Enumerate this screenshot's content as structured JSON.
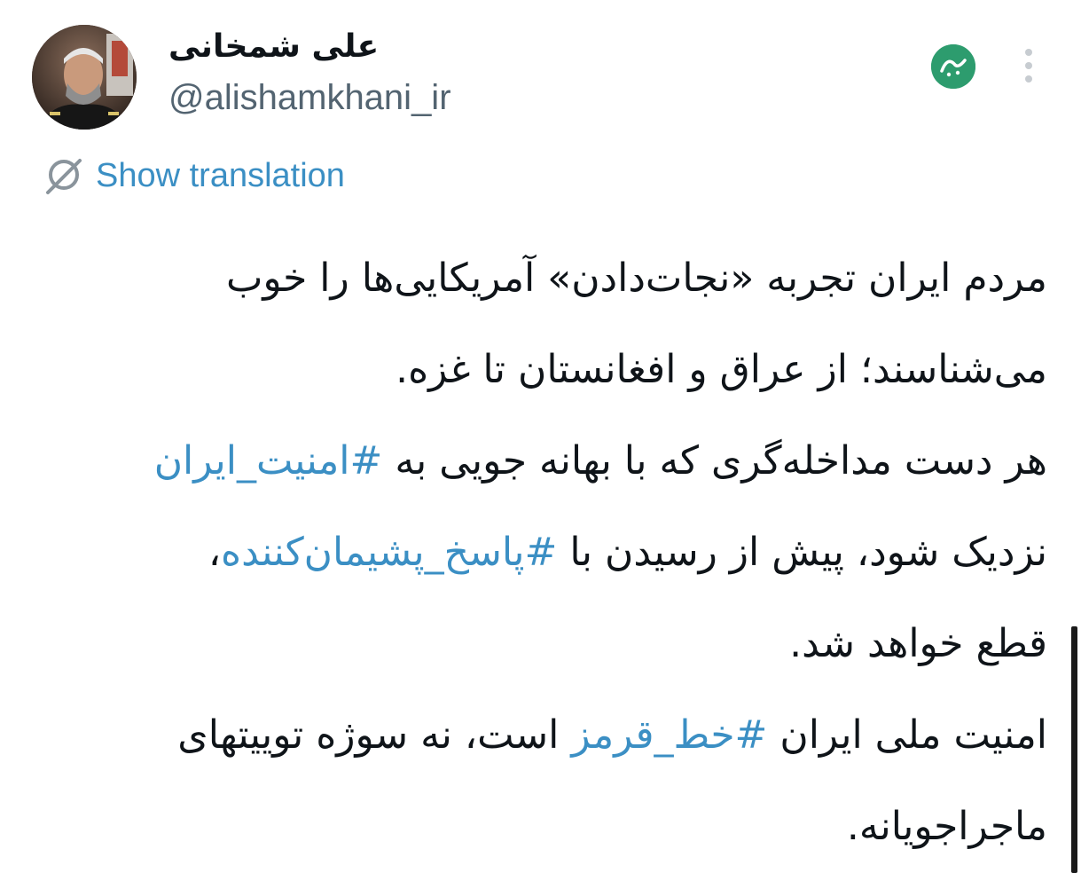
{
  "author": {
    "display_name": "علی شمخانی",
    "handle": "@alishamkhani_ir",
    "avatar_icon": "profile-photo"
  },
  "badge_icon": "channel-logo-icon",
  "more_icon": "more-vertical-icon",
  "translate": {
    "icon": "translate-icon",
    "label": "Show translation"
  },
  "tweet": {
    "line1": "مردم ایران تجربه «نجات‌دادن» آمریکایی‌ها را خوب",
    "line2": "می‌شناسند؛ از عراق و افغانستان تا غزه.",
    "line3_text": "هر دست مداخله‌گری که با بهانه جویی به ",
    "hashtag1": "#امنیت_ایران",
    "line4_text": "نزدیک شود، پیش از رسیدن با ",
    "hashtag2": "#پاسخ_پشیمان‌کننده",
    "line4_end": "،",
    "line5": "قطع خواهد شد.",
    "line6_text": "امنیت ملی ایران ",
    "hashtag3": "#خط_قرمز",
    "line6_end": " است، نه سوژه توییتهای",
    "line7": "ماجراجویانه."
  },
  "colors": {
    "link": "#3b8fc4",
    "text": "#0f1419",
    "muted": "#536471",
    "badge": "#2d9c6e"
  }
}
